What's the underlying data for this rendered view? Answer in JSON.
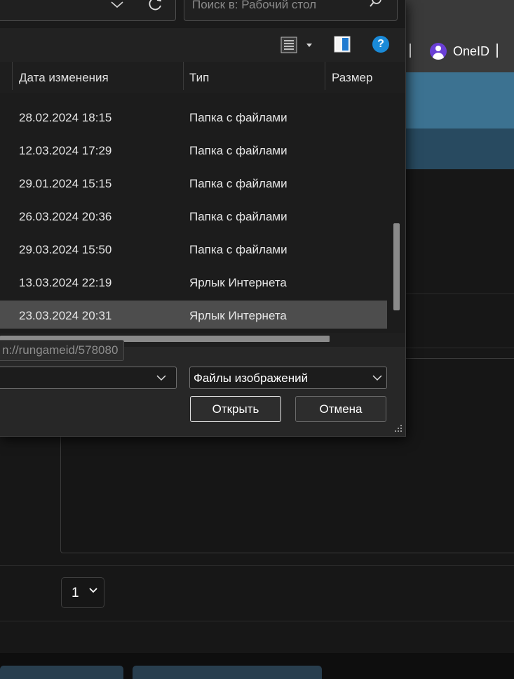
{
  "background_page": {
    "user_label": "OneID",
    "page_select_value": "1",
    "colors": {
      "banner": "#3c7291",
      "banner_dark": "#284a60",
      "avatar": "#6a3fd6",
      "footer_button": "#283e4e"
    }
  },
  "dialog": {
    "search_placeholder": "Поиск в: Рабочий стол",
    "icons": [
      "chevron-down-icon",
      "refresh-icon",
      "search-icon",
      "view-list-icon",
      "preview-pane-icon",
      "help-icon"
    ],
    "help_label": "?",
    "columns": [
      {
        "label": "Дата изменения"
      },
      {
        "label": "Тип"
      },
      {
        "label": "Размер"
      }
    ],
    "rows": [
      {
        "date": "28.02.2024 18:15",
        "type": "Папка с файлами"
      },
      {
        "date": "12.03.2024 17:29",
        "type": "Папка с файлами"
      },
      {
        "date": "29.01.2024 15:15",
        "type": "Папка с файлами"
      },
      {
        "date": "26.03.2024 20:36",
        "type": "Папка с файлами"
      },
      {
        "date": "29.03.2024 15:50",
        "type": "Папка с файлами"
      },
      {
        "date": "13.03.2024 22:19",
        "type": "Ярлык Интернета"
      },
      {
        "date": "23.03.2024 20:31",
        "type": "Ярлык Интернета",
        "selected": true
      }
    ],
    "tooltip_url": "n://rungameid/578080",
    "filename_value": "",
    "filetype_value": "Файлы изображений",
    "open_button": "Открыть",
    "cancel_button": "Отмена"
  }
}
